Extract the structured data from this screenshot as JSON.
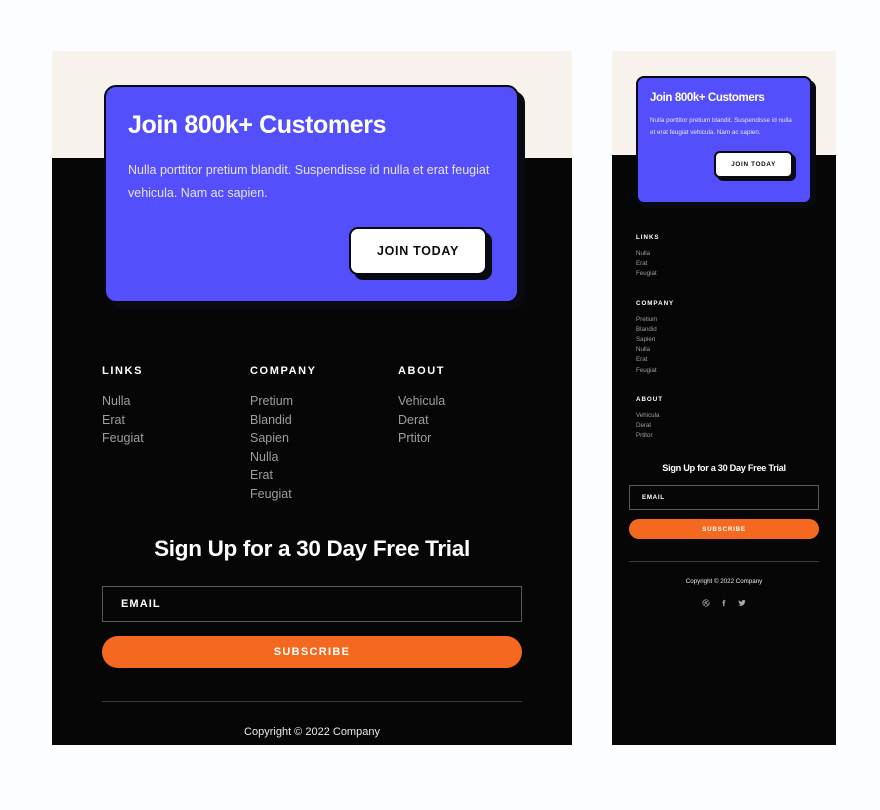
{
  "colors": {
    "page_background": "#fcfdff",
    "panel_background": "#060606",
    "hero_blue": "#544ffc",
    "cream_band": "#f7f2ec",
    "accent_orange": "#f4681f",
    "shadow_black": "#0a0a12",
    "muted_link": "#9d9d9d"
  },
  "hero": {
    "title": "Join 800k+ Customers",
    "body": "Nulla porttitor pretium blandit. Suspendisse id nulla et erat feugiat vehicula. Nam ac sapien.",
    "cta_label": "JOIN TODAY"
  },
  "footer_columns": [
    {
      "heading": "LINKS",
      "links": [
        "Nulla",
        "Erat",
        "Feugiat"
      ]
    },
    {
      "heading": "COMPANY",
      "links": [
        "Pretium",
        "Blandid",
        "Sapien",
        "Nulla",
        "Erat",
        "Feugiat"
      ]
    },
    {
      "heading": "ABOUT",
      "links": [
        "Vehicula",
        "Derat",
        "Prtitor"
      ]
    }
  ],
  "signup": {
    "title": "Sign Up for a 30 Day Free Trial",
    "email_placeholder": "EMAIL",
    "email_value": "",
    "subscribe_label": "SUBSCRIBE"
  },
  "bottom": {
    "copyright": "Copyright © 2022 Company",
    "social": [
      {
        "name": "dribbble-icon"
      },
      {
        "name": "facebook-icon"
      },
      {
        "name": "twitter-icon"
      }
    ]
  }
}
